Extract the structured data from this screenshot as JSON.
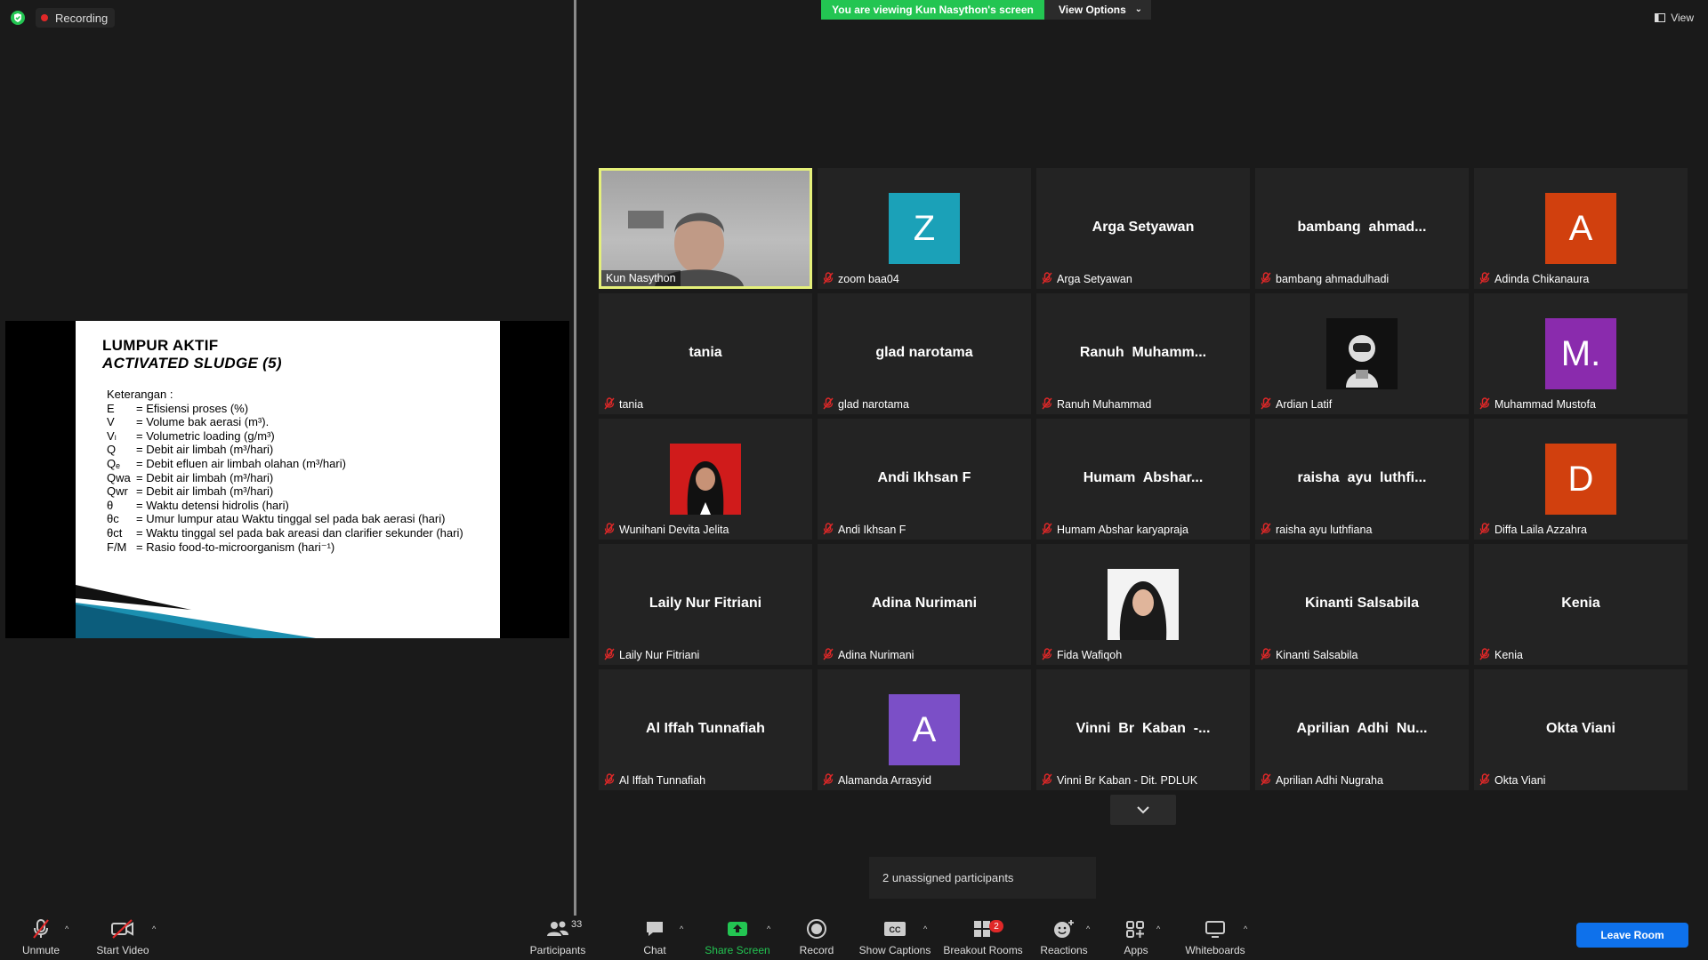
{
  "recording": {
    "label": "Recording"
  },
  "banner": {
    "viewing": "You are viewing Kun Nasython's screen",
    "view_options": "View Options"
  },
  "view_button": {
    "label": "View"
  },
  "slide": {
    "title_line1": "LUMPUR AKTIF",
    "title_line2": "ACTIVATED SLUDGE (5)",
    "keterangan": "Keterangan :",
    "rows": [
      {
        "sym": "E",
        "desc": "= Efisiensi proses (%)"
      },
      {
        "sym": "V",
        "desc": "= Volume bak aerasi (m³)."
      },
      {
        "sym": "Vₗ",
        "desc": "= Volumetric loading (g/m³)"
      },
      {
        "sym": "Q",
        "desc": "= Debit air limbah (m³/hari)"
      },
      {
        "sym": "Qₑ",
        "desc": "= Debit efluen air limbah olahan (m³/hari)"
      },
      {
        "sym": "Qwa",
        "desc": "= Debit air limbah (m³/hari)"
      },
      {
        "sym": "Qwr",
        "desc": "= Debit air limbah (m³/hari)"
      },
      {
        "sym": "θ",
        "desc": "= Waktu detensi hidrolis (hari)"
      },
      {
        "sym": "θc",
        "desc": "= Umur lumpur atau Waktu tinggal sel pada bak aerasi (hari)"
      },
      {
        "sym": "θct",
        "desc": "= Waktu tinggal sel pada bak areasi dan clarifier sekunder (hari)"
      },
      {
        "sym": "F/M",
        "desc": "= Rasio food-to-microorganism (hari⁻¹)"
      }
    ]
  },
  "participants": [
    {
      "label": "Kun Nasython",
      "center": "",
      "type": "video"
    },
    {
      "label": "zoom baa04",
      "center": "Z",
      "type": "letter",
      "color": "#1ba1b8"
    },
    {
      "label": "Arga Setyawan",
      "center": "Arga Setyawan",
      "type": "name"
    },
    {
      "label": "bambang ahmadulhadi",
      "center": "bambang  ahmad...",
      "type": "name"
    },
    {
      "label": "Adinda Chikanaura",
      "center": "A",
      "type": "letter",
      "color": "#d1400e"
    },
    {
      "label": "tania",
      "center": "tania",
      "type": "name"
    },
    {
      "label": "glad narotama",
      "center": "glad narotama",
      "type": "name"
    },
    {
      "label": "Ranuh Muhammad",
      "center": "Ranuh  Muhamm...",
      "type": "name"
    },
    {
      "label": "Ardian Latif",
      "center": "",
      "type": "photo-astronaut"
    },
    {
      "label": "Muhammad Mustofa",
      "center": "M.",
      "type": "letter",
      "color": "#8a2bad"
    },
    {
      "label": "Wunihani Devita Jelita",
      "center": "",
      "type": "photo-red"
    },
    {
      "label": "Andi Ikhsan F",
      "center": "Andi Ikhsan F",
      "type": "name"
    },
    {
      "label": "Humam Abshar karyapraja",
      "center": "Humam  Abshar...",
      "type": "name"
    },
    {
      "label": "raisha ayu luthfiana",
      "center": "raisha  ayu  luthfi...",
      "type": "name"
    },
    {
      "label": "Diffa Laila Azzahra",
      "center": "D",
      "type": "letter",
      "color": "#d1400e"
    },
    {
      "label": "Laily Nur Fitriani",
      "center": "Laily Nur Fitriani",
      "type": "name"
    },
    {
      "label": "Adina Nurimani",
      "center": "Adina Nurimani",
      "type": "name"
    },
    {
      "label": "Fida Wafiqoh",
      "center": "",
      "type": "photo-white"
    },
    {
      "label": "Kinanti Salsabila",
      "center": "Kinanti Salsabila",
      "type": "name"
    },
    {
      "label": "Kenia",
      "center": "Kenia",
      "type": "name"
    },
    {
      "label": "Al Iffah Tunnafiah",
      "center": "Al Iffah Tunnafiah",
      "type": "name"
    },
    {
      "label": "Alamanda Arrasyid",
      "center": "A",
      "type": "letter",
      "color": "#7b4fc7"
    },
    {
      "label": "Vinni Br Kaban - Dit. PDLUK",
      "center": "Vinni  Br  Kaban  -...",
      "type": "name"
    },
    {
      "label": "Aprilian Adhi Nugraha",
      "center": "Aprilian  Adhi  Nu...",
      "type": "name"
    },
    {
      "label": "Okta Viani",
      "center": "Okta Viani",
      "type": "name"
    }
  ],
  "unassigned": "2 unassigned participants",
  "toolbar": {
    "unmute": "Unmute",
    "start_video": "Start Video",
    "participants": "Participants",
    "participants_count": "33",
    "chat": "Chat",
    "share_screen": "Share Screen",
    "record": "Record",
    "show_captions": "Show Captions",
    "breakout_rooms": "Breakout Rooms",
    "breakout_badge": "2",
    "reactions": "Reactions",
    "apps": "Apps",
    "whiteboards": "Whiteboards",
    "leave_room": "Leave Room"
  },
  "colors": {
    "accent_green": "#23c552",
    "leave_blue": "#0e71eb",
    "active_border": "#e5f07a",
    "muted_red": "#e02828"
  }
}
